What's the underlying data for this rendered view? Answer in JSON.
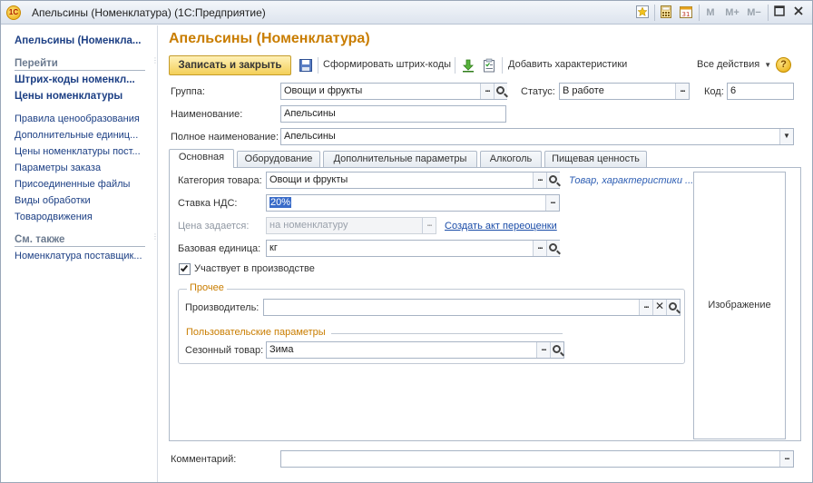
{
  "window": {
    "title": "Апельсины (Номенклатура)  (1С:Предприятие)",
    "logo_text": "1С",
    "buttons": [
      "M",
      "M+",
      "M−"
    ]
  },
  "left_panel": {
    "title": "Апельсины (Номенкла...",
    "goto_header": "Перейти",
    "goto_bold": [
      "Штрих-коды номенкл...",
      "Цены номенклатуры"
    ],
    "links": [
      "Правила ценообразования",
      "Дополнительные единиц...",
      "Цены номенклатуры пост...",
      "Параметры заказа",
      "Присоединенные файлы",
      "Виды обработки",
      "Товародвижения"
    ],
    "see_also_header": "См. также",
    "see_also": [
      "Номенклатура поставщик..."
    ]
  },
  "header": {
    "title": "Апельсины (Номенклатура)"
  },
  "toolbar": {
    "save_close": "Записать и закрыть",
    "barcodes": "Сформировать штрих-коды",
    "add_characteristics": "Добавить характеристики",
    "all_actions": "Все действия",
    "help": "?"
  },
  "fields": {
    "group_label": "Группа:",
    "group_value": "Овощи и фрукты",
    "status_label": "Статус:",
    "status_value": "В работе",
    "code_label": "Код:",
    "code_value": "6",
    "name_label": "Наименование:",
    "name_value": "Апельсины",
    "full_name_label": "Полное наименование:",
    "full_name_value": "Апельсины",
    "comment_label": "Комментарий:",
    "comment_value": ""
  },
  "tabs": [
    "Основная",
    "Оборудование",
    "Дополнительные параметры",
    "Алкоголь",
    "Пищевая ценность"
  ],
  "main_tab": {
    "category_label": "Категория товара:",
    "category_value": "Овощи и фрукты",
    "category_link": "Товар, характеристики ...",
    "vat_label": "Ставка НДС:",
    "vat_value": "20%",
    "price_label": "Цена задается:",
    "price_value": "на номенклатуру",
    "price_link": "Создать акт переоценки",
    "unit_label": "Базовая единица:",
    "unit_value": "кг",
    "production_label": "Участвует в производстве",
    "production_checked": true,
    "other_group": "Прочее",
    "manufacturer_label": "Производитель:",
    "manufacturer_value": "",
    "user_params_group": "Пользовательские параметры",
    "seasonal_label": "Сезонный товар:",
    "seasonal_value": "Зима",
    "image_label": "Изображение"
  },
  "colors": {
    "title_orange": "#c97d00",
    "link_blue": "#1c3f84",
    "selection": "#3a6cc9"
  }
}
